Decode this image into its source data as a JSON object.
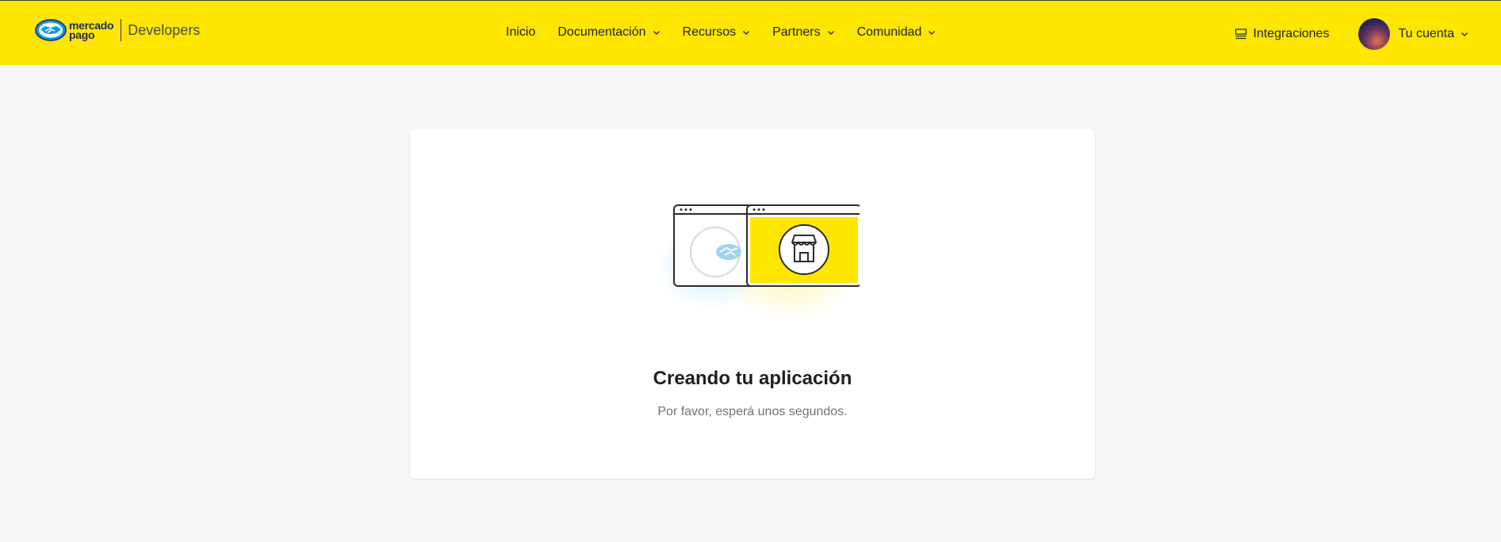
{
  "header": {
    "logo": {
      "brand_line1": "mercado",
      "brand_line2": "pago",
      "product": "Developers",
      "icon": "handshake-logo-icon"
    },
    "nav": [
      {
        "label": "Inicio",
        "has_dropdown": false
      },
      {
        "label": "Documentación",
        "has_dropdown": true
      },
      {
        "label": "Recursos",
        "has_dropdown": true
      },
      {
        "label": "Partners",
        "has_dropdown": true
      },
      {
        "label": "Comunidad",
        "has_dropdown": true
      }
    ],
    "integrations": {
      "label": "Integraciones",
      "icon": "integrations-icon"
    },
    "account": {
      "label": "Tu cuenta",
      "icon": "chevron-down-icon"
    }
  },
  "main": {
    "title": "Creando tu aplicación",
    "subtitle": "Por favor, esperá unos segundos.",
    "illustration_icons": [
      "browser-window-icon",
      "handshake-icon",
      "store-icon"
    ]
  },
  "colors": {
    "header_bg": "#ffe600",
    "page_bg": "#f5f6f7",
    "card_bg": "#ffffff",
    "accent_yellow": "#ffe600",
    "brand_blue": "#009ee3",
    "brand_navy": "#2d3277"
  }
}
